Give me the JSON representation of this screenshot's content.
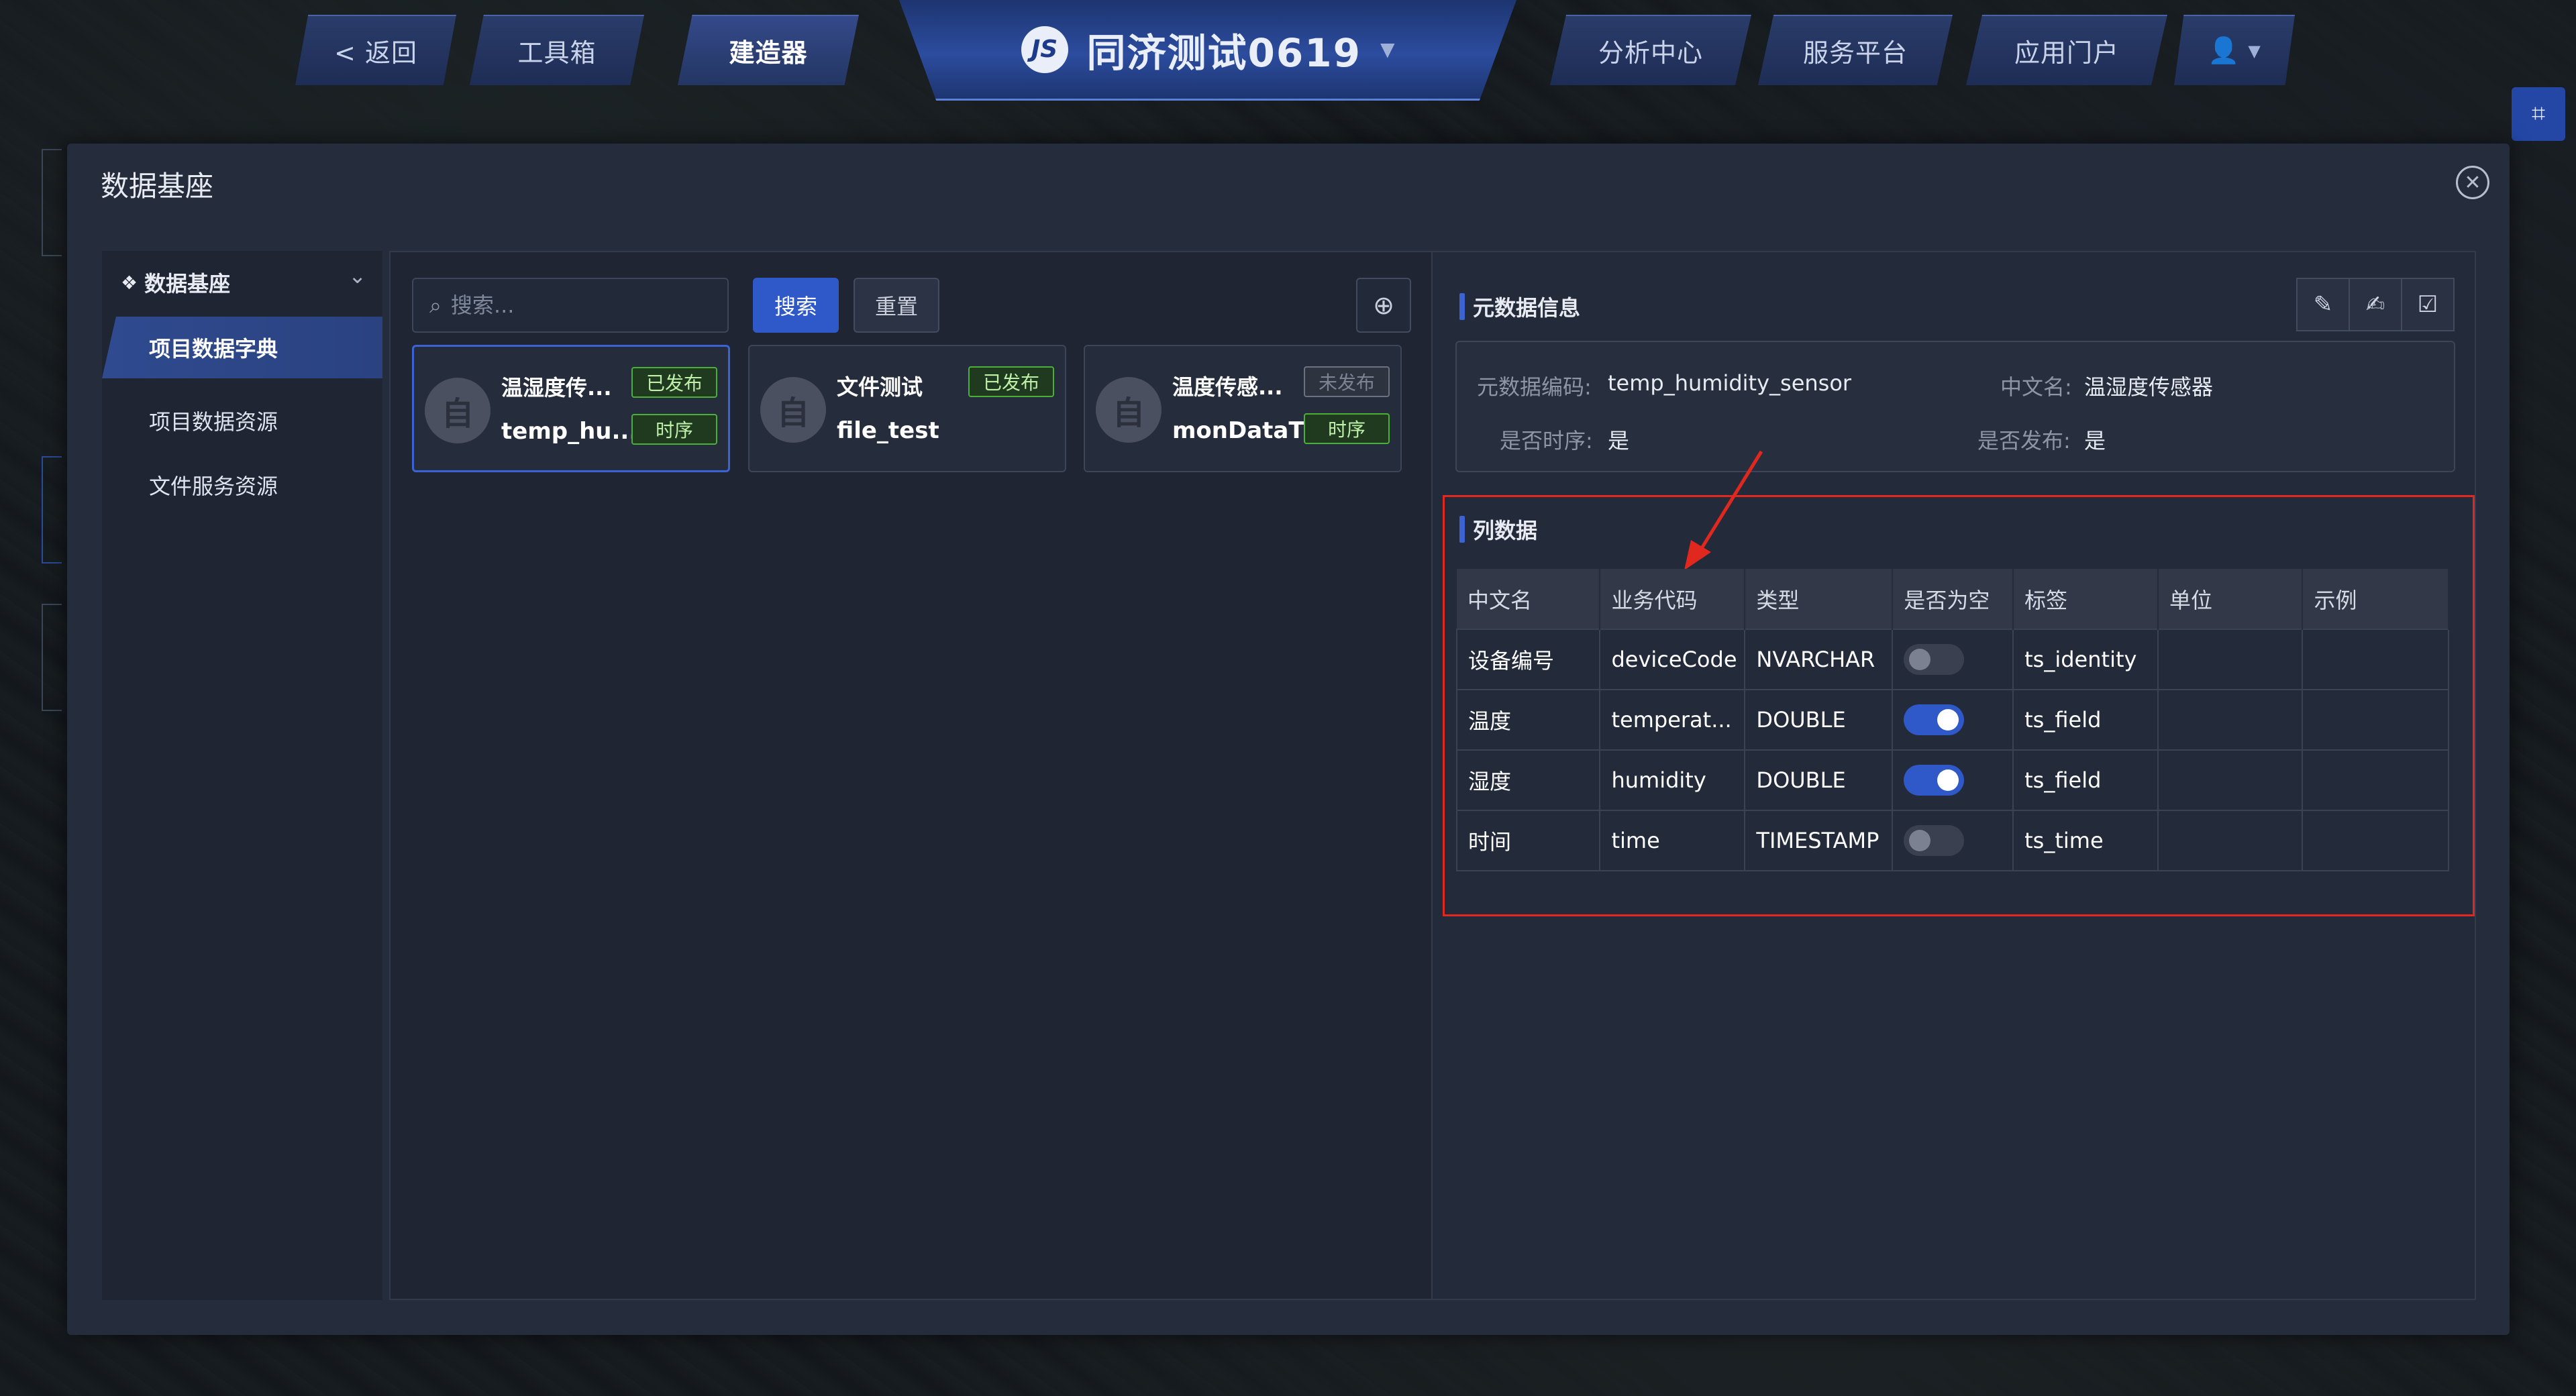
{
  "nav": {
    "back": "< 返回",
    "toolbox": "工具箱",
    "builder": "建造器",
    "project_title": "同济测试0619",
    "analysis": "分析中心",
    "service": "服务平台",
    "portal": "应用门户"
  },
  "modal": {
    "title": "数据基座"
  },
  "menu": {
    "head": "数据基座",
    "items": [
      "项目数据字典",
      "项目数据资源",
      "文件服务资源"
    ]
  },
  "search": {
    "placeholder": "搜索...",
    "search_label": "搜索",
    "reset_label": "重置"
  },
  "cards": [
    {
      "name": "温湿度传...",
      "code": "temp_hu...",
      "status": "已发布",
      "type": "时序"
    },
    {
      "name": "文件测试",
      "code": "file_test",
      "status": "已发布",
      "type": ""
    },
    {
      "name": "温度传感...",
      "code": "monDataT",
      "status": "未发布",
      "type": "时序"
    }
  ],
  "avatar_char": "自",
  "meta": {
    "section_title": "元数据信息",
    "code_label": "元数据编码:",
    "code_value": "temp_humidity_sensor",
    "cn_label": "中文名:",
    "cn_value": "温湿度传感器",
    "ts_label": "是否时序:",
    "ts_value": "是",
    "pub_label": "是否发布:",
    "pub_value": "是"
  },
  "columns": {
    "section_title": "列数据",
    "headers": [
      "中文名",
      "业务代码",
      "类型",
      "是否为空",
      "标签",
      "单位",
      "示例"
    ],
    "rows": [
      {
        "cn": "设备编号",
        "code": "deviceCode",
        "type": "NVARCHAR",
        "nullable": false,
        "tag": "ts_identity",
        "unit": "",
        "example": ""
      },
      {
        "cn": "温度",
        "code": "temperat...",
        "type": "DOUBLE",
        "nullable": true,
        "tag": "ts_field",
        "unit": "",
        "example": ""
      },
      {
        "cn": "湿度",
        "code": "humidity",
        "type": "DOUBLE",
        "nullable": true,
        "tag": "ts_field",
        "unit": "",
        "example": ""
      },
      {
        "cn": "时间",
        "code": "time",
        "type": "TIMESTAMP",
        "nullable": false,
        "tag": "ts_time",
        "unit": "",
        "example": ""
      }
    ]
  },
  "colors": {
    "accent": "#2f58c8",
    "highlight": "#e0281f",
    "published": "#4caf3a"
  }
}
